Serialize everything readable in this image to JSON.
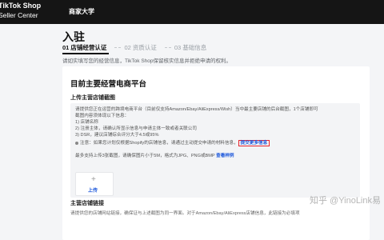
{
  "header": {
    "logo_line1": "TikTok Shop",
    "logo_line2": "Seller Center",
    "title": "商家大学"
  },
  "page": {
    "title": "入驻",
    "steps": [
      {
        "label": "01 店铺经营认证",
        "active": true
      },
      {
        "label": "02 资质认证",
        "active": false
      },
      {
        "label": "03 基础信息",
        "active": false
      }
    ],
    "notice": "请如实填写您的经营信息，TikTok Shop保留核实信息并拒绝申请的权利。"
  },
  "card": {
    "title": "目前主要经营电商平台",
    "upload_section_label": "上传主营店铺截图",
    "description_lines": [
      "请提供您正在运营的跨境电商平台（目前仅支持Amazon/Ebay/AliExpress/Wish）当中最主要店铺的后台截图，1个店铺即可",
      "截图内容须体现以下信息：",
      "1) 店铺名称",
      "2) 注册主体，请确认所显示信息与申请主体一致或者关联公司",
      "3) DSR，建议店铺综合评分大于4.5或95%"
    ],
    "note_prefix": "注意：如果您计划仅根据Shopify的店铺信息，请通过主动提交申请的材料信息，",
    "note_link": "提交更多信息",
    "upload_limit_text": "最多支持上传3张截图，请确保图片小于5M，格式为JPG、PNG或BMP",
    "upload_limit_link": "查看样例",
    "upload_plus": "+",
    "upload_label": "上传",
    "link_section_label": "主营店铺链接",
    "link_note": "请提供您的店铺网站链接，确保证与上述截图为同一界面。对于Amazon/Ebay/AliExpress店铺信息，此链接为必填项"
  },
  "watermark": "知乎 @YinoLink易"
}
